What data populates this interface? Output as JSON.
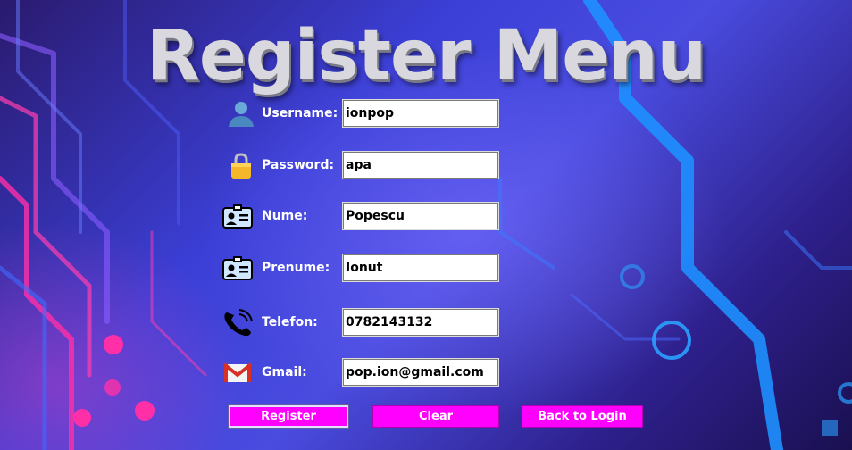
{
  "title": "Register Menu",
  "fields": [
    {
      "label": "Username:",
      "value": "ionpop",
      "icon": "user-icon"
    },
    {
      "label": "Password:",
      "value": "apa",
      "icon": "lock-icon"
    },
    {
      "label": "Nume:",
      "value": "Popescu",
      "icon": "id-card-icon"
    },
    {
      "label": "Prenume:",
      "value": "Ionut",
      "icon": "id-card-icon"
    },
    {
      "label": "Telefon:",
      "value": "0782143132",
      "icon": "phone-icon"
    },
    {
      "label": "Gmail:",
      "value": "pop.ion@gmail.com",
      "icon": "gmail-icon"
    }
  ],
  "buttons": {
    "register": "Register",
    "clear": "Clear",
    "back": "Back to Login"
  },
  "colors": {
    "button_bg": "#ff00ff",
    "circuit_pink": "#ff2fa8",
    "circuit_blue": "#1e90ff"
  }
}
